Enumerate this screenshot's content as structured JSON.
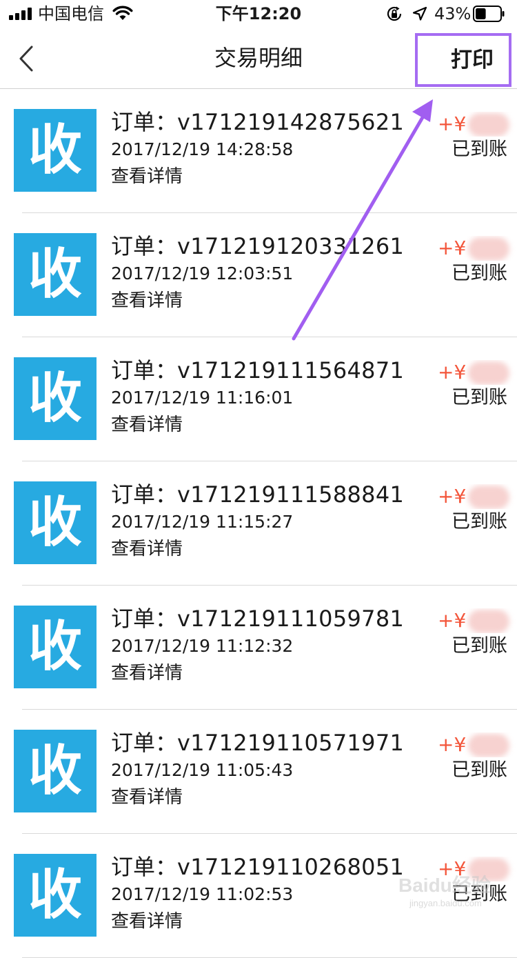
{
  "status_bar": {
    "carrier": "中国电信",
    "time": "下午12:20",
    "battery_percent": "43%",
    "battery_level": 0.43,
    "icons": [
      "signal-icon",
      "wifi-icon",
      "rotation-lock-icon",
      "location-icon",
      "battery-icon"
    ]
  },
  "nav": {
    "back_icon": "chevron-left-icon",
    "title": "交易明细",
    "print_label": "打印"
  },
  "transactions": [
    {
      "icon_text": "收",
      "order_label": "订单：",
      "order_number": "v171219142875621",
      "time": "2017/12/19 14:28:58",
      "detail_label": "查看详情",
      "amount_prefix": "+¥",
      "status": "已到账"
    },
    {
      "icon_text": "收",
      "order_label": "订单：",
      "order_number": "v171219120331261",
      "time": "2017/12/19 12:03:51",
      "detail_label": "查看详情",
      "amount_prefix": "+¥",
      "status": "已到账"
    },
    {
      "icon_text": "收",
      "order_label": "订单：",
      "order_number": "v171219111564871",
      "time": "2017/12/19 11:16:01",
      "detail_label": "查看详情",
      "amount_prefix": "+¥",
      "status": "已到账"
    },
    {
      "icon_text": "收",
      "order_label": "订单：",
      "order_number": "v171219111588841",
      "time": "2017/12/19 11:15:27",
      "detail_label": "查看详情",
      "amount_prefix": "+¥",
      "status": "已到账"
    },
    {
      "icon_text": "收",
      "order_label": "订单：",
      "order_number": "v171219111059781",
      "time": "2017/12/19 11:12:32",
      "detail_label": "查看详情",
      "amount_prefix": "+¥",
      "status": "已到账"
    },
    {
      "icon_text": "收",
      "order_label": "订单：",
      "order_number": "v171219110571971",
      "time": "2017/12/19 11:05:43",
      "detail_label": "查看详情",
      "amount_prefix": "+¥",
      "status": "已到账"
    },
    {
      "icon_text": "收",
      "order_label": "订单：",
      "order_number": "v171219110268051",
      "time": "2017/12/19 11:02:53",
      "detail_label": "查看详情",
      "amount_prefix": "+¥",
      "status": "已到账"
    }
  ],
  "watermark": {
    "brand": "Baidu经验",
    "url": "jingyan.baidu.com"
  },
  "colors": {
    "icon_background": "#27aae1",
    "amount": "#f3553a",
    "highlight_box": "#a56cf2",
    "divider": "#d9d9d9"
  }
}
